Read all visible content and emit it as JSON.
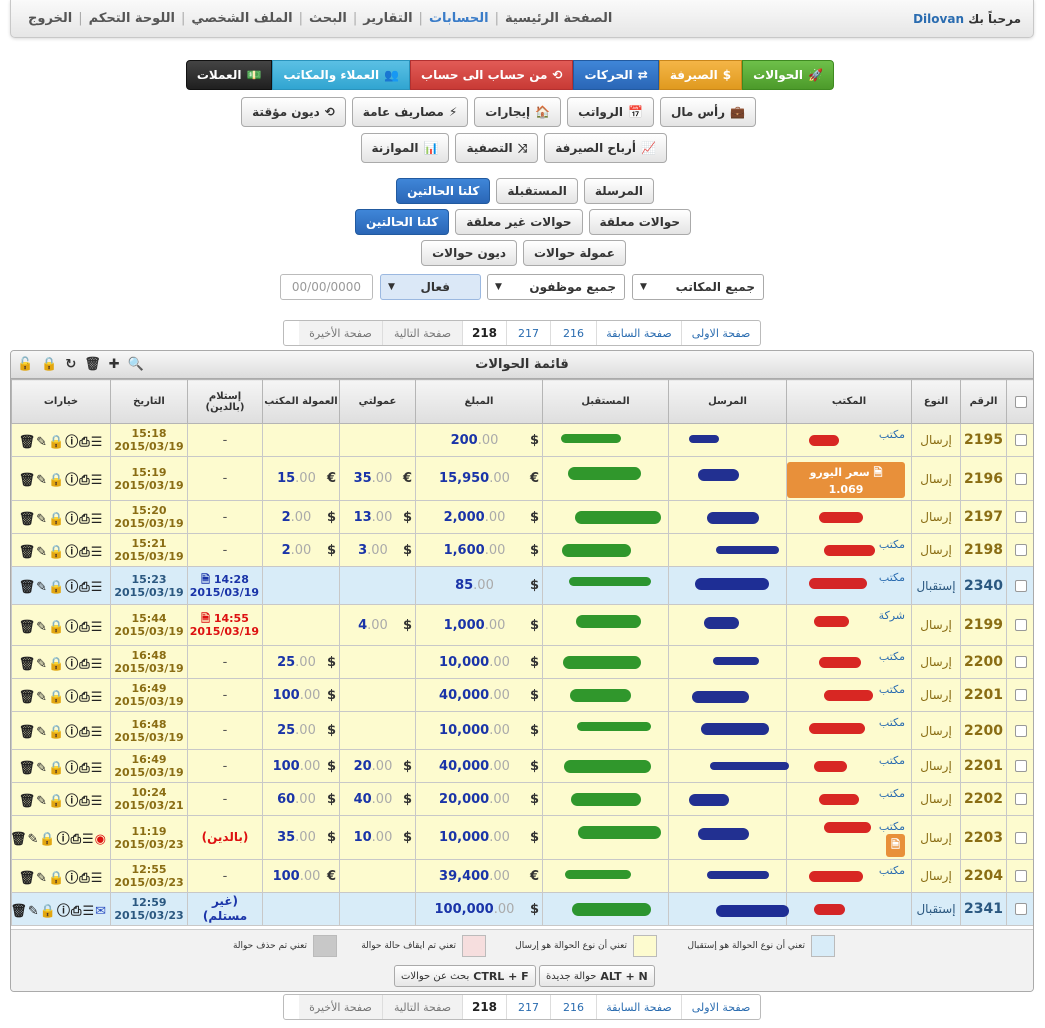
{
  "nav": {
    "welcome": "مرحباً بك",
    "user": "Dilovan",
    "links": [
      "الصفحة الرئيسية",
      "الحسابات",
      "التقارير",
      "البحث",
      "الملف الشخصي",
      "اللوحة التحكم",
      "الخروج"
    ]
  },
  "row1": [
    {
      "label": "الحوالات",
      "icon": "🚀"
    },
    {
      "label": "الصيرفة",
      "icon": "$"
    },
    {
      "label": "الحركات",
      "icon": "⇄"
    },
    {
      "label": "من حساب الى حساب",
      "icon": "⟲"
    },
    {
      "label": "العملاء والمكاتب",
      "icon": "👥"
    },
    {
      "label": "العملات",
      "icon": "💵"
    }
  ],
  "row2": [
    {
      "label": "رأس مال",
      "icon": "💼"
    },
    {
      "label": "الرواتب",
      "icon": "📅"
    },
    {
      "label": "إيجارات",
      "icon": "🏠"
    },
    {
      "label": "مصاريف عامة",
      "icon": "⚡"
    },
    {
      "label": "ديون مؤقتة",
      "icon": "⟲"
    }
  ],
  "row3": [
    {
      "label": "أرباح الصيرفة",
      "icon": "📈"
    },
    {
      "label": "التصفية",
      "icon": "⤨"
    },
    {
      "label": "الموازنة",
      "icon": "📊"
    }
  ],
  "row4": [
    "المرسلة",
    "المستقبلة",
    "كلتا الحالتين"
  ],
  "row5": [
    "حوالات معلقة",
    "حوالات غير معلقة",
    "كلتا الحالتين"
  ],
  "row6": [
    "عمولة حوالات",
    "ديون حوالات"
  ],
  "filters": {
    "offices": "جميع المكاتب",
    "employees": "جميع موظفون",
    "status": "فعال",
    "date": "00/00/0000"
  },
  "pager": {
    "first": "صفحة الاولى",
    "prev": "صفحة السابقة",
    "p1": "216",
    "p2": "217",
    "current": "218",
    "next": "صفحة التالية",
    "last": "صفحة الأخيرة"
  },
  "panel": {
    "title": "قائمة الحوالات"
  },
  "headers": [
    "",
    "الرقم",
    "النوع",
    "المكتب",
    "المرسل",
    "المستقبل",
    "المبلغ",
    "عمولتي",
    "العمولة المكتب",
    "إستلام (بالدين)",
    "التاريخ",
    "خيارات"
  ],
  "rows": [
    {
      "id": "2195",
      "type": "إرسال",
      "office": "مكتب",
      "amount": "200",
      "amt_cur": "$",
      "my": "",
      "my_cur": "",
      "off": "",
      "off_cur": "",
      "recv": "-",
      "time": "15:18",
      "date": "2015/03/19",
      "cls": "y"
    },
    {
      "id": "2196",
      "type": "إرسال",
      "office": "",
      "badge": "سعر اليورو 1.069",
      "amount": "15,950",
      "amt_cur": "€",
      "my": "35",
      "my_cur": "€",
      "off": "15",
      "off_cur": "€",
      "recv": "-",
      "time": "15:19",
      "date": "2015/03/19",
      "cls": "y"
    },
    {
      "id": "2197",
      "type": "إرسال",
      "office": "",
      "amount": "2,000",
      "amt_cur": "$",
      "my": "13",
      "my_cur": "$",
      "off": "2",
      "off_cur": "$",
      "recv": "-",
      "time": "15:20",
      "date": "2015/03/19",
      "cls": "y"
    },
    {
      "id": "2198",
      "type": "إرسال",
      "office": "مكتب",
      "amount": "1,600",
      "amt_cur": "$",
      "my": "3",
      "my_cur": "$",
      "off": "2",
      "off_cur": "$",
      "recv": "-",
      "time": "15:21",
      "date": "2015/03/19",
      "cls": "y"
    },
    {
      "id": "2340",
      "type": "إستقبال",
      "office": "مكتب",
      "amount": "85",
      "amt_cur": "$",
      "my": "",
      "my_cur": "",
      "off": "",
      "off_cur": "",
      "recv_time": "14:28",
      "recv_date": "2015/03/19",
      "time": "15:23",
      "date": "2015/03/19",
      "cls": "b"
    },
    {
      "id": "2199",
      "type": "إرسال",
      "office": "شركة",
      "amount": "1,000",
      "amt_cur": "$",
      "my": "4",
      "my_cur": "$",
      "off": "",
      "off_cur": "",
      "recv_time": "14:55",
      "recv_date": "2015/03/19",
      "recv_red": true,
      "time": "15:44",
      "date": "2015/03/19",
      "cls": "y"
    },
    {
      "id": "2200",
      "type": "إرسال",
      "office": "مكتب",
      "amount": "10,000",
      "amt_cur": "$",
      "my": "",
      "my_cur": "",
      "off": "25",
      "off_cur": "$",
      "recv": "-",
      "time": "16:48",
      "date": "2015/03/19",
      "cls": "y"
    },
    {
      "id": "2201",
      "type": "إرسال",
      "office": "مكتب",
      "amount": "40,000",
      "amt_cur": "$",
      "my": "",
      "my_cur": "",
      "off": "100",
      "off_cur": "$",
      "recv": "-",
      "time": "16:49",
      "date": "2015/03/19",
      "cls": "y"
    },
    {
      "id": "2200",
      "type": "إرسال",
      "office": "مكتب",
      "amount": "10,000",
      "amt_cur": "$",
      "my": "",
      "my_cur": "",
      "off": "25",
      "off_cur": "$",
      "recv": "-",
      "time": "16:48",
      "date": "2015/03/19",
      "cls": "y"
    },
    {
      "id": "2201",
      "type": "إرسال",
      "office": "مكتب",
      "amount": "40,000",
      "amt_cur": "$",
      "my": "20",
      "my_cur": "$",
      "off": "100",
      "off_cur": "$",
      "recv": "-",
      "time": "16:49",
      "date": "2015/03/19",
      "cls": "y"
    },
    {
      "id": "2202",
      "type": "إرسال",
      "office": "مكتب",
      "amount": "20,000",
      "amt_cur": "$",
      "my": "40",
      "my_cur": "$",
      "off": "60",
      "off_cur": "$",
      "recv": "-",
      "time": "10:24",
      "date": "2015/03/21",
      "cls": "y"
    },
    {
      "id": "2203",
      "type": "إرسال",
      "office": "مكتب",
      "badge": " ",
      "amount": "10,000",
      "amt_cur": "$",
      "my": "10",
      "my_cur": "$",
      "off": "35",
      "off_cur": "$",
      "recv": "(بالدين)",
      "recv_red": true,
      "time": "11:19",
      "date": "2015/03/23",
      "cls": "y",
      "target": true
    },
    {
      "id": "2204",
      "type": "إرسال",
      "office": "مكتب",
      "amount": "39,400",
      "amt_cur": "€",
      "my": "",
      "my_cur": "",
      "off": "100",
      "off_cur": "€",
      "recv": "-",
      "time": "12:55",
      "date": "2015/03/23",
      "cls": "y"
    },
    {
      "id": "2341",
      "type": "إستقبال",
      "office": "",
      "amount": "100,000",
      "amt_cur": "$",
      "my": "",
      "my_cur": "",
      "off": "",
      "off_cur": "",
      "recv": "(غير مستلم)",
      "time": "12:59",
      "date": "2015/03/23",
      "cls": "b",
      "mail": true
    }
  ],
  "legend": {
    "recv": "تعني أن نوع الحوالة هو إستقبال",
    "send": "تعني أن نوع الحوالة هو إرسال",
    "stopped": "تعني تم ايقاف حالة حوالة",
    "deleted": "تعني تم حذف حوالة",
    "new_key": "ALT + N",
    "new_label": "حوالة جديدة",
    "find_key": "CTRL + F",
    "find_label": "بحث عن حوالات"
  },
  "colors": {
    "recv": "#d8ecf8",
    "send": "#fdfbcf",
    "stopped": "#f6dede",
    "deleted": "#c8c8c8"
  }
}
